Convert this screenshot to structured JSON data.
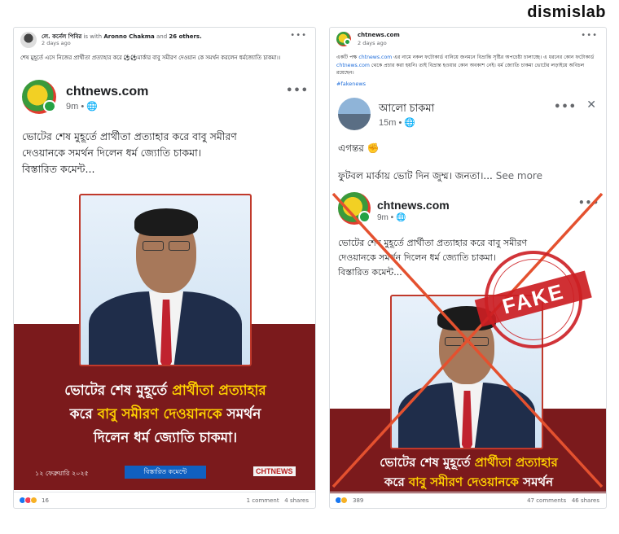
{
  "brand": "dismislab",
  "left_post": {
    "author": "লে. কর্নেল পিবির",
    "with_text": "is with",
    "tagged": "Aronno Chakma",
    "and_text": "and",
    "others": "26 others.",
    "time": "2 days ago",
    "caption": "শেষ মুহূর্তে এসে নিজের প্রার্থীতা প্রত্যাহার করে ⚽⚽মার্কার বাবু সমীরণ দেওয়ান কে সমর্থন করলেন ধর্মজ্যোতি চাকমা।।",
    "card": {
      "source": "chtnews.com",
      "meta": "9m • 🌐",
      "text_lines": [
        "ভোটের শেষ মুহূর্তে প্রার্থীতা প্রত্যাহার করে বাবু সমীরণ",
        "দেওয়ানকে সমর্থন দিলেন ধর্ম জ্যোতি চাকমা।",
        "বিস্তারিত কমেন্ট..."
      ],
      "headline_line1a": "ভোটের শেষ মুহূর্তে ",
      "headline_line1b": "প্রার্থীতা প্রত্যাহার",
      "headline_line2a": "করে ",
      "headline_line2b": "বাবু সমীরণ দেওয়ানকে",
      "headline_line2c": " সমর্থন",
      "headline_line3": "দিলেন ধর্ম জ্যোতি চাকমা।",
      "date": "১২ ফেব্রুয়ারি ২০২৫",
      "detail_button": "বিস্তারিত কমেন্টে",
      "logo_text": "CHTNEWS"
    },
    "reaction_count": "16",
    "comments": "1 comment",
    "shares": "4 shares"
  },
  "right_post": {
    "author": "chtnews.com",
    "time": "2 days ago",
    "caption_pre": "একটি পক্ষ ",
    "caption_link1": "chtnews.com",
    "caption_mid": " এর নামে নকল ফটোকার্ড বানিয়ে জনমনে বিভ্রান্তি সৃষ্টির অপচেষ্টা চালাচ্ছে। এ ধরনের কোন ফটোকার্ড ",
    "caption_link2": "chtnews.com",
    "caption_post": " থেকে প্রচার করা হয়নি। তাই বিভ্রান্ত হওয়ার কোন অবকাশ নেই। ধর্ম জ্যোতি চাকমা ভোটের লড়াইয়ে অবিচল রয়েছেন।",
    "hashtag": "#fakenews",
    "shared_post": {
      "author": "আলো চাকমা",
      "meta": "15m • 🌐",
      "line1": "এগন্তর ✊",
      "line2": "ফুটবল মার্কায় ভোট দিন জুম্ম। জনতা।...",
      "see_more": "See more"
    },
    "card": {
      "source": "chtnews.com",
      "meta": "9m • 🌐",
      "text_lines": [
        "ভোটের শেষ মুহূর্তে প্রার্থীতা প্রত্যাহার করে বাবু সমীরণ",
        "দেওয়ানকে সমর্থন দিলেন ধর্ম জ্যোতি চাকমা।",
        "বিস্তারিত কমেন্ট..."
      ],
      "headline_line1a": "ভোটের শেষ মুহূর্তে ",
      "headline_line1b": "প্রার্থীতা প্রত্যাহার",
      "headline_line2a": "করে ",
      "headline_line2b": "বাবু সমীরণ দেওয়ানকে",
      "headline_line2c": " সমর্থন"
    },
    "stamp_word": "FAKE",
    "reaction_count": "389",
    "comments": "47 comments",
    "shares": "46 shares"
  }
}
